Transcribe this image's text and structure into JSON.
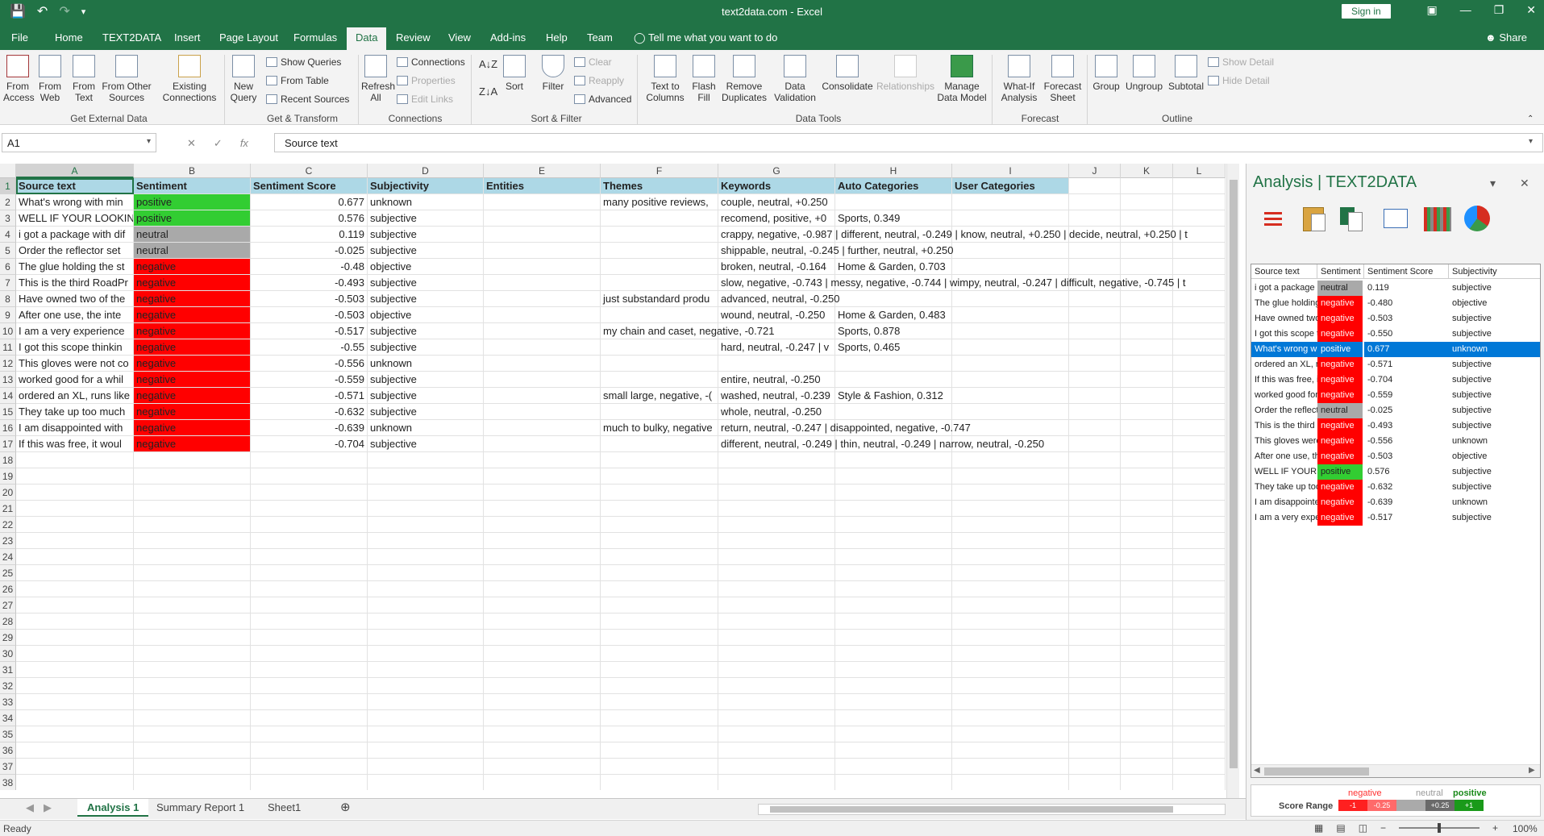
{
  "window": {
    "title": "text2data.com - Excel",
    "sign_in": "Sign in",
    "share": "Share"
  },
  "menu_tabs": [
    "File",
    "Home",
    "TEXT2DATA",
    "Insert",
    "Page Layout",
    "Formulas",
    "Data",
    "Review",
    "View",
    "Add-ins",
    "Help",
    "Team"
  ],
  "active_tab": "Data",
  "tell_me": "Tell me what you want to do",
  "ribbon": {
    "external": {
      "from_access": "From Access",
      "from_web": "From Web",
      "from_text": "From Text",
      "from_other": "From Other Sources",
      "existing": "Existing Connections",
      "group": "Get External Data"
    },
    "transform": {
      "new_query": "New Query",
      "show_queries": "Show Queries",
      "from_table": "From Table",
      "recent_sources": "Recent Sources",
      "group": "Get & Transform"
    },
    "connections": {
      "refresh_all": "Refresh All",
      "connections": "Connections",
      "properties": "Properties",
      "edit_links": "Edit Links",
      "group": "Connections"
    },
    "sortfilter": {
      "sort": "Sort",
      "filter": "Filter",
      "clear": "Clear",
      "reapply": "Reapply",
      "advanced": "Advanced",
      "group": "Sort & Filter"
    },
    "datatools": {
      "text_to_columns": "Text to Columns",
      "flash_fill": "Flash Fill",
      "remove_duplicates": "Remove Duplicates",
      "data_validation": "Data Validation",
      "consolidate": "Consolidate",
      "relationships": "Relationships",
      "manage_model": "Manage Data Model",
      "group": "Data Tools"
    },
    "forecast": {
      "what_if": "What-If Analysis",
      "forecast_sheet": "Forecast Sheet",
      "group": "Forecast"
    },
    "outline": {
      "group_btn": "Group",
      "ungroup": "Ungroup",
      "subtotal": "Subtotal",
      "show_detail": "Show Detail",
      "hide_detail": "Hide Detail",
      "group": "Outline"
    }
  },
  "namebox": "A1",
  "formula": "Source text",
  "columns": [
    "A",
    "B",
    "C",
    "D",
    "E",
    "F",
    "G",
    "H",
    "I",
    "J",
    "K",
    "L"
  ],
  "headers": [
    "Source text",
    "Sentiment",
    "Sentiment Score",
    "Subjectivity",
    "Entities",
    "Themes",
    "Keywords",
    "Auto Categories",
    "User Categories"
  ],
  "rows": [
    {
      "text": "What's wrong with min",
      "sentiment": "positive",
      "score": "0.677",
      "subj": "unknown",
      "themes": "many positive reviews,",
      "keywords": "couple, neutral, +0.250",
      "auto": ""
    },
    {
      "text": "WELL IF YOUR LOOKING",
      "sentiment": "positive",
      "score": "0.576",
      "subj": "subjective",
      "themes": "",
      "keywords": "recomend, positive, +0",
      "auto": "Sports, 0.349"
    },
    {
      "text": "i got a package with dif",
      "sentiment": "neutral",
      "score": "0.119",
      "subj": "subjective",
      "themes": "",
      "keywords": "crappy, negative, -0.987 | different, neutral, -0.249 | know, neutral, +0.250 | decide, neutral, +0.250 | t",
      "auto": ""
    },
    {
      "text": "Order the reflector set",
      "sentiment": "neutral",
      "score": "-0.025",
      "subj": "subjective",
      "themes": "",
      "keywords": "shippable, neutral, -0.245 | further, neutral, +0.250",
      "auto": ""
    },
    {
      "text": "The glue holding the st",
      "sentiment": "negative",
      "score": "-0.48",
      "subj": "objective",
      "themes": "",
      "keywords": "broken, neutral, -0.164",
      "auto": "Home & Garden, 0.703"
    },
    {
      "text": "This is the third RoadPr",
      "sentiment": "negative",
      "score": "-0.493",
      "subj": "subjective",
      "themes": "",
      "keywords": "slow, negative, -0.743 | messy, negative, -0.744 | wimpy, neutral, -0.247 | difficult, negative, -0.745 | t",
      "auto": ""
    },
    {
      "text": "Have owned two of the",
      "sentiment": "negative",
      "score": "-0.503",
      "subj": "subjective",
      "themes": "just substandard produ",
      "keywords": "advanced, neutral, -0.250",
      "auto": ""
    },
    {
      "text": "After one use, the inte",
      "sentiment": "negative",
      "score": "-0.503",
      "subj": "objective",
      "themes": "",
      "keywords": "wound, neutral, -0.250",
      "auto": "Home & Garden, 0.483"
    },
    {
      "text": "I am a very experience",
      "sentiment": "negative",
      "score": "-0.517",
      "subj": "subjective",
      "themes": "my chain and caset, negative, -0.721",
      "keywords": "",
      "auto": "Sports, 0.878"
    },
    {
      "text": "I got this scope thinkin",
      "sentiment": "negative",
      "score": "-0.55",
      "subj": "subjective",
      "themes": "",
      "keywords": "hard, neutral, -0.247 | v",
      "auto": "Sports, 0.465"
    },
    {
      "text": "This gloves were not co",
      "sentiment": "negative",
      "score": "-0.556",
      "subj": "unknown",
      "themes": "",
      "keywords": "",
      "auto": ""
    },
    {
      "text": "worked good for a whil",
      "sentiment": "negative",
      "score": "-0.559",
      "subj": "subjective",
      "themes": "",
      "keywords": "entire, neutral, -0.250",
      "auto": ""
    },
    {
      "text": "ordered an XL, runs like",
      "sentiment": "negative",
      "score": "-0.571",
      "subj": "subjective",
      "themes": "small large, negative, -(",
      "keywords": "washed, neutral, -0.239",
      "auto": "Style & Fashion, 0.312"
    },
    {
      "text": "They take up too much",
      "sentiment": "negative",
      "score": "-0.632",
      "subj": "subjective",
      "themes": "",
      "keywords": "whole, neutral, -0.250",
      "auto": ""
    },
    {
      "text": "I am disappointed with",
      "sentiment": "negative",
      "score": "-0.639",
      "subj": "unknown",
      "themes": "much to bulky, negative",
      "keywords": "return, neutral, -0.247 | disappointed, negative, -0.747",
      "auto": ""
    },
    {
      "text": "If this was free, it woul",
      "sentiment": "negative",
      "score": "-0.704",
      "subj": "subjective",
      "themes": "",
      "keywords": "different, neutral, -0.249 | thin, neutral, -0.249 | narrow, neutral, -0.250",
      "auto": ""
    }
  ],
  "sheets": [
    "Analysis 1",
    "Summary Report 1",
    "Sheet1"
  ],
  "status": {
    "ready": "Ready",
    "zoom": "100%"
  },
  "pane": {
    "title": "Analysis | TEXT2DATA",
    "headers": [
      "Source text",
      "Sentiment",
      "Sentiment Score",
      "Subjectivity"
    ],
    "rows": [
      {
        "text": "i got a package ...",
        "sentiment": "neutral",
        "score": "0.119",
        "subj": "subjective"
      },
      {
        "text": "The glue holding ...",
        "sentiment": "negative",
        "score": "-0.480",
        "subj": "objective"
      },
      {
        "text": "Have owned two...",
        "sentiment": "negative",
        "score": "-0.503",
        "subj": "subjective"
      },
      {
        "text": "I got this scope t...",
        "sentiment": "negative",
        "score": "-0.550",
        "subj": "subjective"
      },
      {
        "text": "What's wrong wit...",
        "sentiment": "positive",
        "score": "0.677",
        "subj": "unknown"
      },
      {
        "text": "ordered an XL, ru...",
        "sentiment": "negative",
        "score": "-0.571",
        "subj": "subjective"
      },
      {
        "text": "If this was free, it ...",
        "sentiment": "negative",
        "score": "-0.704",
        "subj": "subjective"
      },
      {
        "text": "worked good for ...",
        "sentiment": "negative",
        "score": "-0.559",
        "subj": "subjective"
      },
      {
        "text": "Order the reflecto...",
        "sentiment": "neutral",
        "score": "-0.025",
        "subj": "subjective"
      },
      {
        "text": "This is the third R...",
        "sentiment": "negative",
        "score": "-0.493",
        "subj": "subjective"
      },
      {
        "text": "This gloves were ...",
        "sentiment": "negative",
        "score": "-0.556",
        "subj": "unknown"
      },
      {
        "text": "After one use, th...",
        "sentiment": "negative",
        "score": "-0.503",
        "subj": "objective"
      },
      {
        "text": "WELL IF YOUR ...",
        "sentiment": "positive",
        "score": "0.576",
        "subj": "subjective"
      },
      {
        "text": "They take up too...",
        "sentiment": "negative",
        "score": "-0.632",
        "subj": "subjective"
      },
      {
        "text": "I am disappointed...",
        "sentiment": "negative",
        "score": "-0.639",
        "subj": "unknown"
      },
      {
        "text": "I am a very experi...",
        "sentiment": "negative",
        "score": "-0.517",
        "subj": "subjective"
      }
    ],
    "selected_row": 4,
    "legend": {
      "negative": "negative",
      "neutral": "neutral",
      "positive": "positive",
      "range_label": "Score Range",
      "m1": "-1",
      "m025": "-0.25",
      "p025": "+0.25",
      "p1": "+1"
    }
  },
  "colors": {
    "excel_green": "#217346",
    "positive": "#32cd32",
    "negative": "#ff0000",
    "neutral": "#a9a9a9",
    "header": "#add8e6",
    "selection": "#0078d7"
  }
}
